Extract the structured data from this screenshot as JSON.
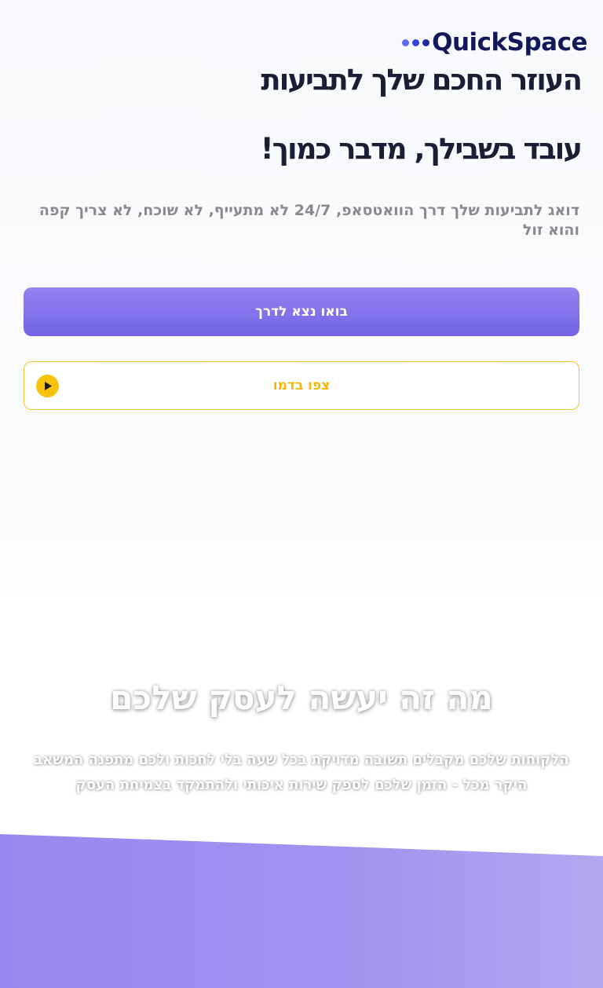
{
  "brand": {
    "name": "QuickSpace",
    "dot_colors": [
      "#5b6cf0",
      "#3444d8",
      "#1f2aa3"
    ]
  },
  "hero": {
    "headline_line1": "העוזר החכם שלך לתביעות",
    "headline_line2": "עובד בשבילך, מדבר כמוך!",
    "subtitle": "דואג לתביעות שלך דרך הוואטסאפ, 24/7 לא מתעייף, לא שוכח, לא צריך קפה והוא זול"
  },
  "buttons": {
    "primary_label": "בואו נצא לדרך",
    "demo_label": "צפו בדמו"
  },
  "icons": {
    "demo_icon": "play-icon"
  },
  "section": {
    "title": "מה זה יעשה לעסק שלכם",
    "body": "הלקוחות שלכם מקבלים תשובה מדויקת בכל שעה בלי לחכות ולכם מתפנה המשאב היקר מכל - הזמן שלכם לספק שירות איכותי ולהתמקד בצמיחת העסק"
  },
  "colors": {
    "primary": "#7b6aea",
    "accent": "#f7c30d",
    "heading": "#1a1f35",
    "brand_text": "#11195a"
  }
}
